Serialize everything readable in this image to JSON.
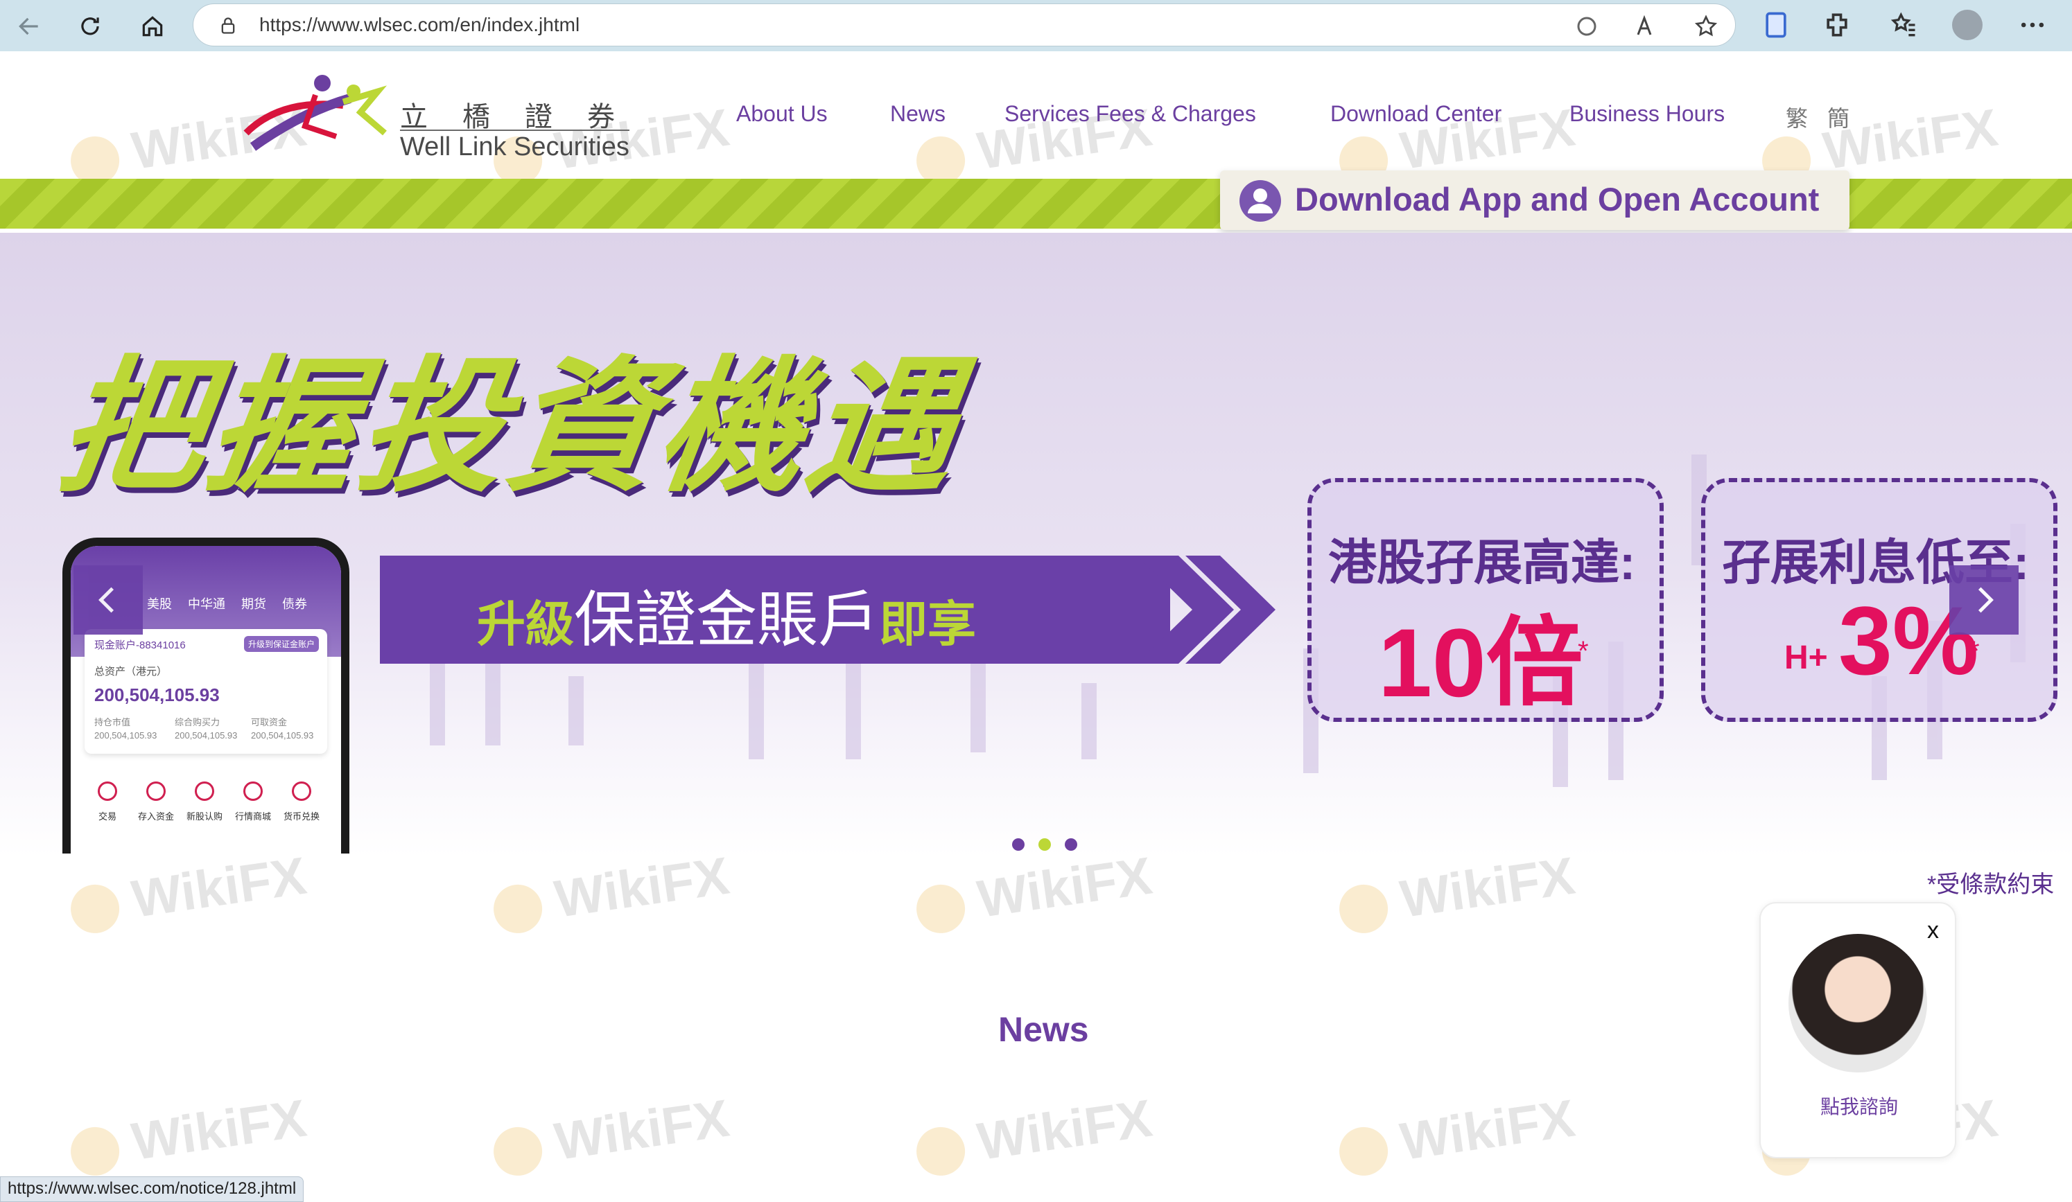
{
  "browser": {
    "url": "https://www.wlsec.com/en/index.jhtml",
    "back_icon": "back-arrow-icon",
    "refresh_icon": "refresh-icon",
    "home_icon": "home-icon"
  },
  "site": {
    "logo": {
      "chinese": "立橋證券",
      "english": "Well Link Securities"
    },
    "menu": {
      "about": "About Us",
      "news": "News",
      "fees": "Services Fees & Charges",
      "download": "Download Center",
      "hours": "Business Hours",
      "trad": "繁",
      "simp": "簡"
    },
    "download_button": "Download App and Open Account"
  },
  "banner": {
    "headline": "把握投資機遇",
    "band_prefix": "升級",
    "band_main": "保證金賬戶",
    "band_suffix": "即享",
    "promo1": {
      "title": "港股孖展高達:",
      "value": "10倍",
      "mark": "*"
    },
    "promo2": {
      "title": "孖展利息低至:",
      "prefix": "H+",
      "value": "3%",
      "mark": "*"
    },
    "terms": "*受條款約束",
    "slide_count": 3,
    "active_slide": 2
  },
  "phone": {
    "tabs": "美股 中华通 期货 债券",
    "account": "现金账户-88341016",
    "badge": "升级到保证金账户",
    "total_label": "总资产（港元）",
    "total_value": "200,504,105.93",
    "cols": [
      {
        "label": "持仓市值",
        "value": "200,504,105.93"
      },
      {
        "label": "综合购买力",
        "value": "200,504,105.93"
      },
      {
        "label": "可取资金",
        "value": "200,504,105.93"
      }
    ],
    "bottom": [
      "交易",
      "存入资金",
      "新股认购",
      "行情商城",
      "货币兑换"
    ]
  },
  "news": {
    "title": "News"
  },
  "chat": {
    "close": "x",
    "label": "點我諮詢"
  },
  "status_url": "https://www.wlsec.com/notice/128.jhtml",
  "watermark": "WikiFX",
  "colors": {
    "purple": "#6b3fa0",
    "lime": "#bcd736",
    "pink": "#e3105e"
  }
}
